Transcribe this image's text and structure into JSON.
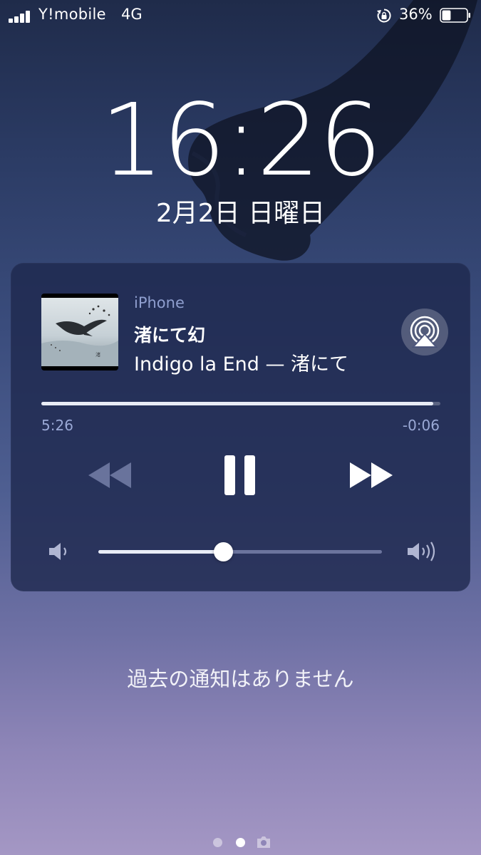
{
  "status_bar": {
    "carrier": "Y!mobile",
    "network": "4G",
    "battery_percent": "36%",
    "signal_icon": "cellular-signal-icon",
    "rotation_lock_icon": "rotation-lock-icon",
    "battery_icon": "battery-icon",
    "battery_level": 0.36
  },
  "lock_screen": {
    "time": "16:26",
    "date": "2月2日 日曜日",
    "no_notifications": "過去の通知はありません"
  },
  "now_playing": {
    "source": "iPhone",
    "title": "渚にて幻",
    "subtitle": "Indigo la End — 渚にて",
    "elapsed": "5:26",
    "remaining": "-0:06",
    "progress": 0.982,
    "volume": 0.44,
    "icons": {
      "airplay": "airplay-icon",
      "rewind": "rewind-icon",
      "pause": "pause-icon",
      "forward": "fast-forward-icon",
      "volume_low": "volume-low-icon",
      "volume_high": "volume-high-icon"
    }
  },
  "pager": {
    "pages": 2,
    "current": 2,
    "camera_icon": "camera-icon"
  },
  "colors": {
    "widget_background": "#1e284e",
    "accent_text": "#8f9fcf",
    "time_labels": "#9aa9d6"
  }
}
